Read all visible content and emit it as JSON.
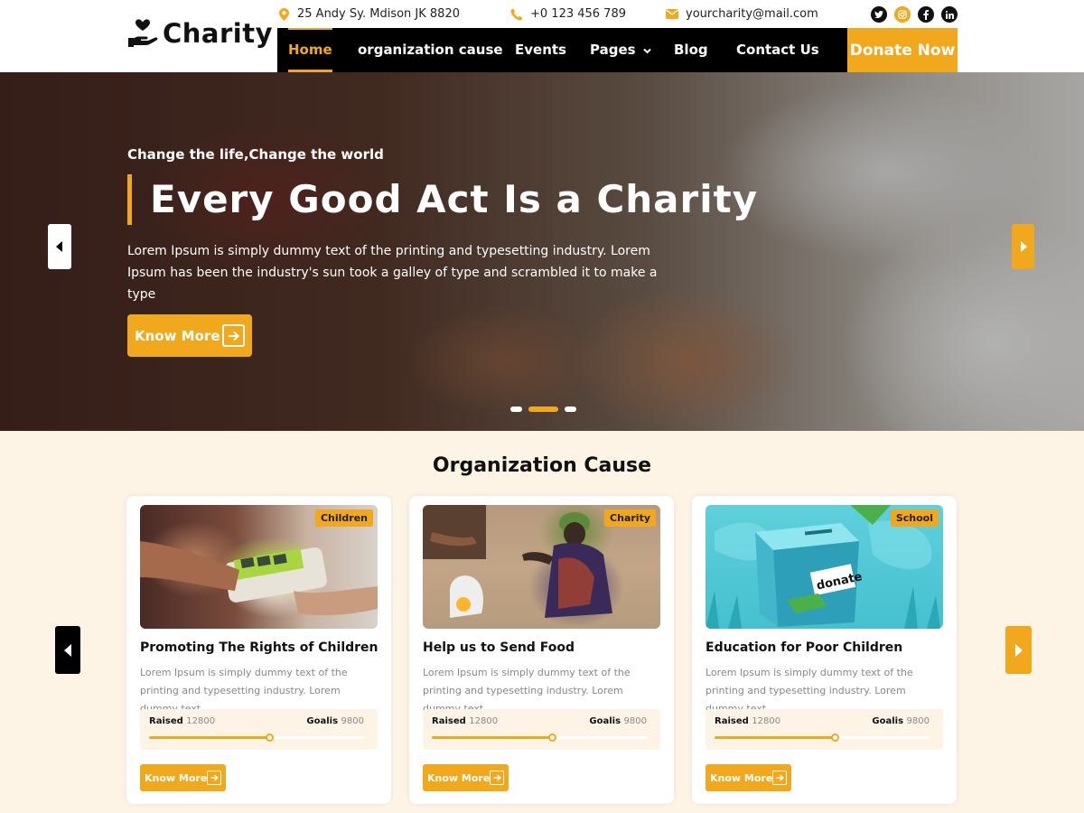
{
  "brand": {
    "name": "Charity"
  },
  "topbar": {
    "address": "25 Andy Sy. Mdison JK 8820",
    "phone": "+0 123 456 789",
    "email": "yourcharity@mail.com",
    "socials": [
      "twitter-icon",
      "instagram-icon",
      "facebook-icon",
      "linkedin-icon"
    ]
  },
  "nav": {
    "items": [
      {
        "label": "Home"
      },
      {
        "label": "organization cause"
      },
      {
        "label": "Events"
      },
      {
        "label": "Pages"
      },
      {
        "label": "Blog"
      },
      {
        "label": "Contact Us"
      }
    ],
    "donate_label": "Donate Now"
  },
  "hero": {
    "subtitle": "Change the life,Change the world",
    "title": "Every Good Act Is a Charity",
    "text": "Lorem Ipsum is simply dummy text of the printing and typesetting industry. Lorem Ipsum has been the industry's sun took a galley of type and scrambled it to make a type",
    "button_label": "Know More",
    "active_slide": 2,
    "slide_count": 3
  },
  "causes": {
    "title": "Organization Cause",
    "cards": [
      {
        "tag": "Children",
        "title": "Promoting The Rights of Children",
        "desc": "Lorem Ipsum is simply dummy text of the printing and typesetting industry. Lorem dummy text",
        "raised_label": "Raised",
        "raised": "12800",
        "goal_label": "Goalis",
        "goal": "9800",
        "progress": 0.56,
        "button_label": "Know More"
      },
      {
        "tag": "Charity",
        "title": "Help us to Send Food",
        "desc": "Lorem Ipsum is simply dummy text of the printing and typesetting industry. Lorem dummy text .",
        "raised_label": "Raised",
        "raised": "12800",
        "goal_label": "Goalis",
        "goal": "9800",
        "progress": 0.56,
        "button_label": "Know More"
      },
      {
        "tag": "School",
        "title": "Education for Poor Children",
        "desc": "Lorem Ipsum is simply dummy text of the printing and typesetting industry. Lorem dummy text .",
        "raised_label": "Raised",
        "raised": "12800",
        "goal_label": "Goalis",
        "goal": "9800",
        "progress": 0.56,
        "button_label": "Know More"
      }
    ]
  },
  "colors": {
    "accent": "#f2a81d",
    "dark": "#000000",
    "section_bg": "#fdf4e6"
  }
}
